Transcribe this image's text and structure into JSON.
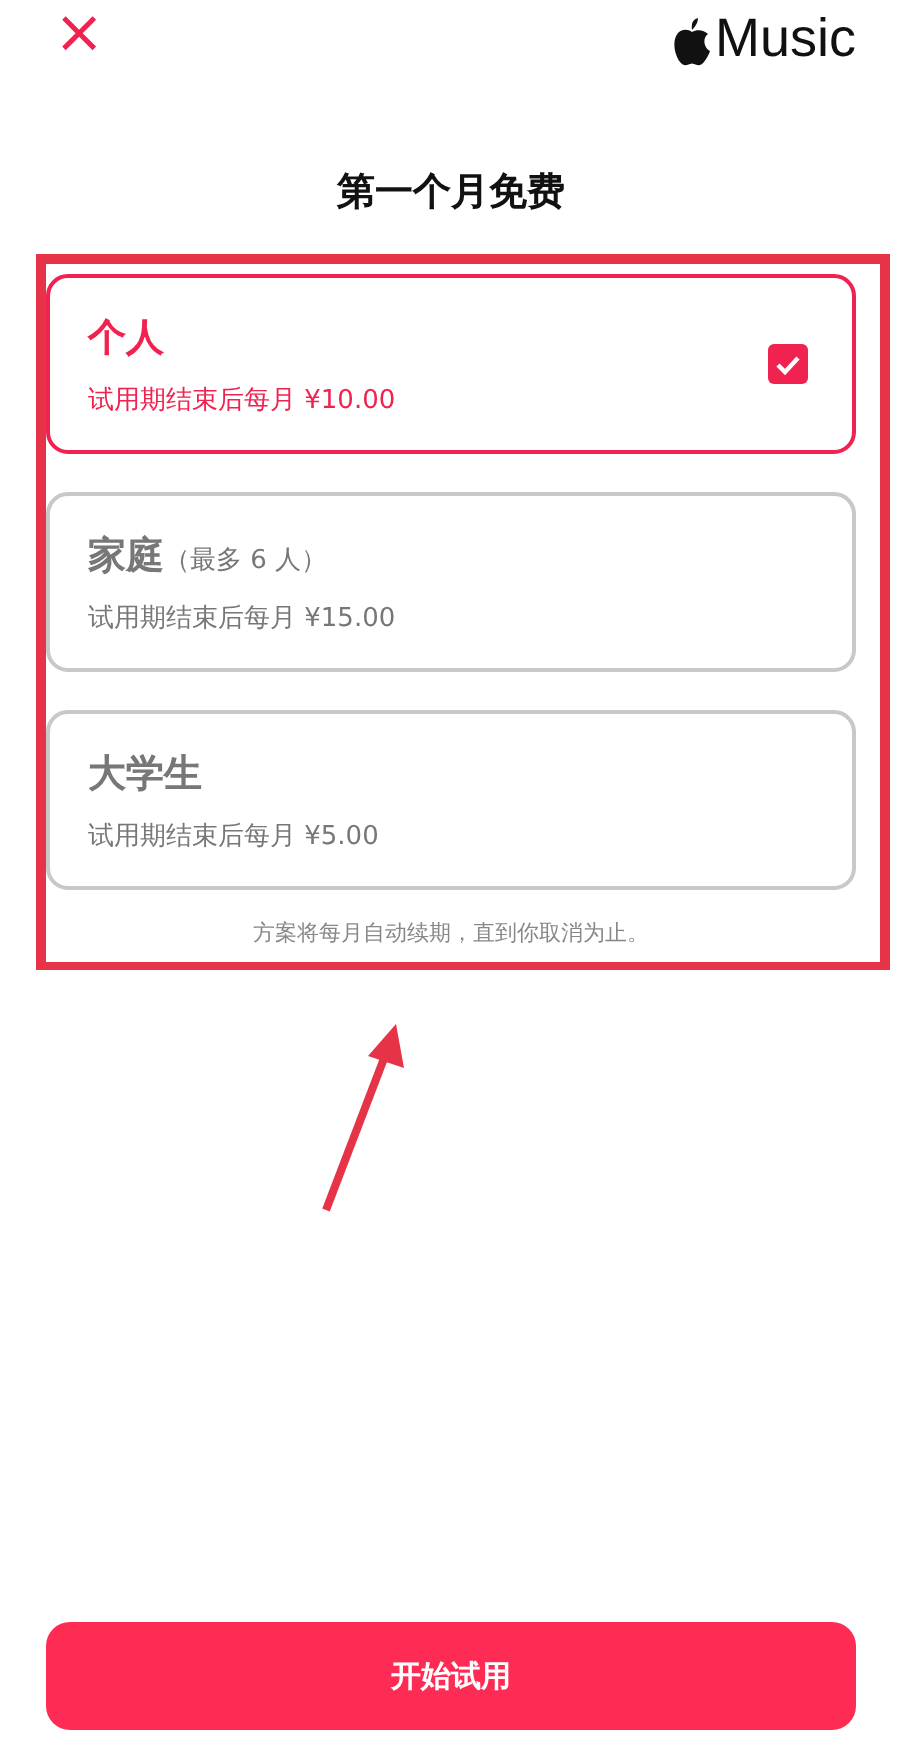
{
  "header": {
    "close": "×",
    "brand": "Music"
  },
  "title": "第一个月免费",
  "plans": [
    {
      "name": "个人",
      "price": "试用期结束后每月 ¥10.00",
      "selected": true
    },
    {
      "name": "家庭",
      "note": "（最多 6 人）",
      "price": "试用期结束后每月 ¥15.00",
      "selected": false
    },
    {
      "name": "大学生",
      "price": "试用期结束后每月 ¥5.00",
      "selected": false
    }
  ],
  "footnote": "方案将每月自动续期，直到你取消为止。",
  "button": "开始试用"
}
